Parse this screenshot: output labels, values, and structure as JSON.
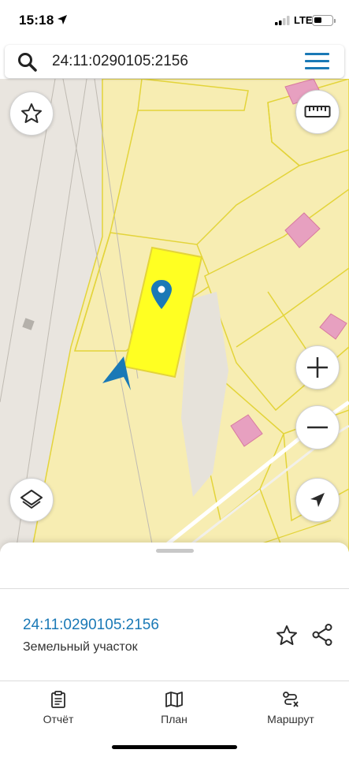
{
  "status_bar": {
    "time": "15:18",
    "network": "LTE",
    "icons": [
      "location-arrow-icon",
      "signal-icon",
      "battery-icon"
    ]
  },
  "search": {
    "value": "24:11:0290105:2156",
    "icon": "search-icon",
    "menu_icon": "menu-icon"
  },
  "map": {
    "parcel_highlight_color": "#ffff22",
    "parcel_border_color": "#e3d43a",
    "land_color": "#f7edb2",
    "building_color": "#e7a0c0",
    "pin_color": "#1a79b6",
    "controls": {
      "favorite": "star-icon",
      "ruler": "ruler-icon",
      "zoom_in": "plus-icon",
      "zoom_out": "minus-icon",
      "layers": "layers-icon",
      "navigate": "navigation-arrow-icon"
    }
  },
  "result": {
    "title": "24:11:0290105:2156",
    "subtitle": "Земельный участок"
  },
  "tabs": [
    {
      "label": "Отчёт",
      "icon": "report-icon"
    },
    {
      "label": "План",
      "icon": "map-icon"
    },
    {
      "label": "Маршрут",
      "icon": "route-icon"
    }
  ],
  "colors": {
    "accent": "#1a79b6"
  }
}
